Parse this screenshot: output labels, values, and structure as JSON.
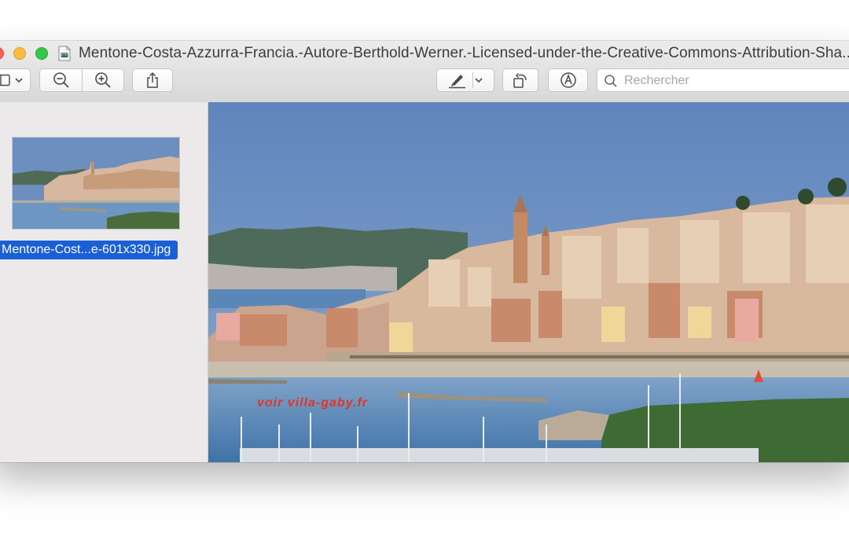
{
  "window": {
    "title": "Mentone-Costa-Azzurra-Francia.-Autore-Berthold-Werner.-Licensed-under-the-Creative-Commons-Attribution-Sha..."
  },
  "toolbar": {
    "icons": [
      "sidebar-icon",
      "chevron-down-icon",
      "zoom-out-icon",
      "zoom-in-icon",
      "share-icon",
      "markup-pen-icon",
      "chevron-down-icon",
      "rotate-icon",
      "annotate-icon",
      "search-icon"
    ]
  },
  "search": {
    "placeholder": "Rechercher"
  },
  "sidebar": {
    "thumbnail_label": "Mentone-Cost...e-601x330.jpg"
  },
  "image": {
    "watermark": "voir   villa-gaby.fr"
  },
  "colors": {
    "selection": "#1a5fd6",
    "sky": "#6d8fc0",
    "sea": "#4b7fb3",
    "watermark": "#e2342a"
  }
}
